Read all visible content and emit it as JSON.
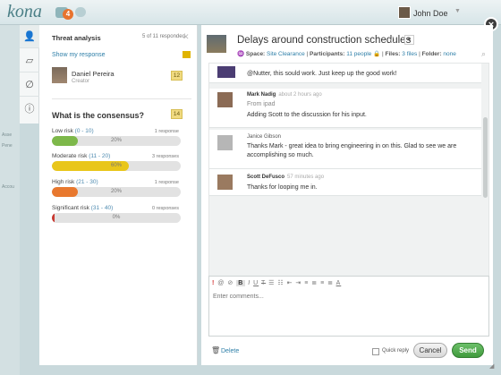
{
  "app": {
    "logo": "kona",
    "notification_count": "4"
  },
  "user": {
    "name": "John Doe"
  },
  "close_glyph": "×",
  "background_text": [
    "Asse",
    "Pene",
    "Accou"
  ],
  "rail_icons": [
    "person-icon",
    "note-icon",
    "paperclip-icon",
    "alert-icon"
  ],
  "left": {
    "title": "Threat analysis",
    "responded": "5 of 11 responded",
    "show_response": "Show my response",
    "creator_name": "Daniel Pereira",
    "creator_role": "Creator",
    "creator_badge": "12",
    "question": "What is the consensus?",
    "question_badge": "14",
    "options": [
      {
        "label": "Low risk",
        "range": "(0 - 10)",
        "responses": "1 response",
        "pct": "20%",
        "value": 0.2,
        "color": "#7db84a"
      },
      {
        "label": "Moderate risk",
        "range": "(11 - 20)",
        "responses": "3 responses",
        "pct": "60%",
        "value": 0.6,
        "color": "#e9c61a"
      },
      {
        "label": "High risk",
        "range": "(21 - 30)",
        "responses": "1 response",
        "pct": "20%",
        "value": 0.2,
        "color": "#e8782e"
      },
      {
        "label": "Significant risk",
        "range": "(31 - 40)",
        "responses": "0 responses",
        "pct": "0%",
        "value": 0.0,
        "color": "#c83a32"
      }
    ]
  },
  "discussion": {
    "title": "Delays around construction schedules",
    "space_label": "Space:",
    "space": "Site Clearance",
    "participants_label": "Participants:",
    "participants": "11 people",
    "files_label": "Files:",
    "files": "3 files",
    "folder_label": "Folder:",
    "folder": "none",
    "messages": [
      {
        "author": "",
        "time": "",
        "sub": "",
        "text": "@Nutter, this sould work. Just keep up the good work!"
      },
      {
        "author": "Mark Nadig",
        "time": "about 2 hours ago",
        "sub": "From ipad",
        "text": "Adding Scott to the discussion for his input."
      },
      {
        "author": "Janice Gibson",
        "time": "",
        "sub": "",
        "text": "Thanks Mark - great idea to bring engineering in on this.  Glad to see we are accomplishing so much."
      },
      {
        "author": "Scott DeFusco",
        "time": "57 minutes ago",
        "sub": "",
        "text": "Thanks for looping me in."
      }
    ]
  },
  "composer": {
    "placeholder": "Enter comments..."
  },
  "actions": {
    "delete": "Delete",
    "quick_reply": "Quick reply",
    "cancel": "Cancel",
    "send": "Send"
  }
}
